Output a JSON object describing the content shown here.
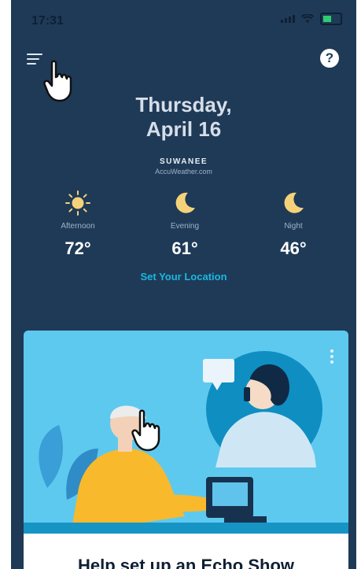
{
  "status_bar": {
    "time": "17:31"
  },
  "header": {
    "menu_icon": "hamburger-menu-icon",
    "help_label": "?"
  },
  "date": {
    "line1": "Thursday,",
    "line2": "April 16"
  },
  "location": {
    "name": "SUWANEE",
    "source": "AccuWeather.com"
  },
  "forecast": [
    {
      "label": "Afternoon",
      "temp": "72°",
      "icon": "sun-icon"
    },
    {
      "label": "Evening",
      "temp": "61°",
      "icon": "moon-icon"
    },
    {
      "label": "Night",
      "temp": "46°",
      "icon": "moon-icon"
    }
  ],
  "set_location": "Set Your Location",
  "promo_card": {
    "title": "Help set up an Echo Show",
    "menu_icon": "more-vertical-icon"
  },
  "colors": {
    "background": "#1f3a57",
    "accent": "#19b8e0",
    "card": "#5ec9ef"
  }
}
